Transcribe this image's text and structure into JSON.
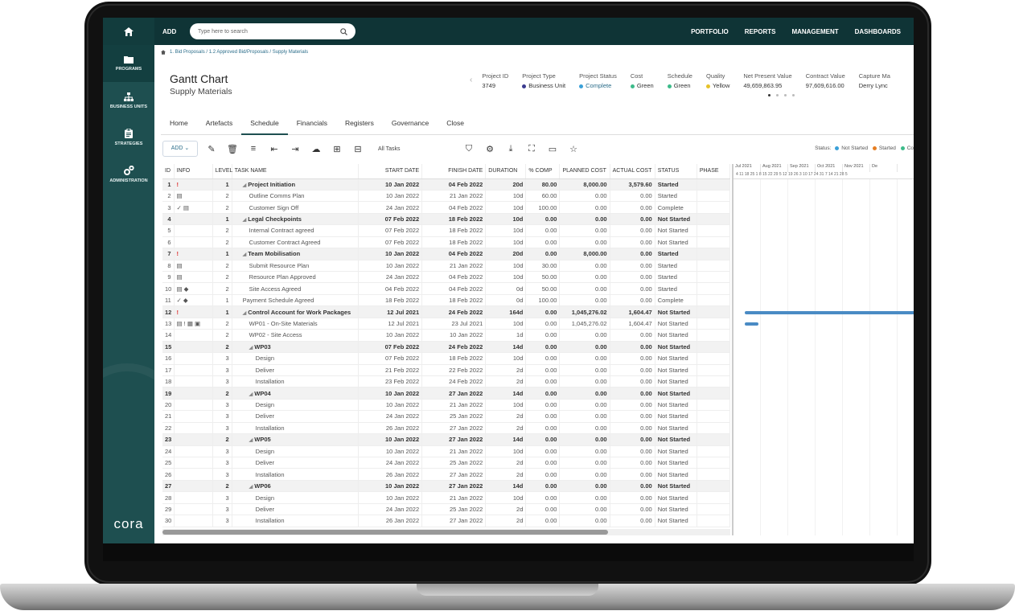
{
  "nav": {
    "items": [
      {
        "label": "PROGRAMS"
      },
      {
        "label": "BUSINESS UNITS"
      },
      {
        "label": "STRATEGIES"
      },
      {
        "label": "ADMINISTRATION"
      }
    ],
    "logo": "cora"
  },
  "topbar": {
    "add_label": "ADD",
    "search_placeholder": "Type here to search",
    "links": [
      "PORTFOLIO",
      "REPORTS",
      "MANAGEMENT",
      "DASHBOARDS"
    ]
  },
  "breadcrumb": "1. Bid Proposals / 1.2 Approved Bid/Proposals / Supply Materials",
  "page": {
    "title": "Gantt Chart",
    "subtitle": "Supply Materials"
  },
  "meta": [
    {
      "label": "Project ID",
      "value": "3749",
      "dot": ""
    },
    {
      "label": "Project Type",
      "value": "Business Unit",
      "dot": "#3b3b8f"
    },
    {
      "label": "Project Status",
      "value": "Complete",
      "dot": "#3aa0d8"
    },
    {
      "label": "Cost",
      "value": "Green",
      "dot": "#3dbb8a"
    },
    {
      "label": "Schedule",
      "value": "Green",
      "dot": "#3dbb8a"
    },
    {
      "label": "Quality",
      "value": "Yellow",
      "dot": "#e6c229"
    },
    {
      "label": "Net Present Value",
      "value": "49,659,863.95",
      "dot": ""
    },
    {
      "label": "Contract Value",
      "value": "97,609,616.00",
      "dot": ""
    },
    {
      "label": "Capture Ma",
      "value": "Derry Lync",
      "dot": ""
    }
  ],
  "tabs": [
    "Home",
    "Artefacts",
    "Schedule",
    "Financials",
    "Registers",
    "Governance",
    "Close"
  ],
  "selected_tab": "Schedule",
  "toolbar": {
    "add_label": "ADD",
    "filter_label": "All Tasks",
    "status_legend": [
      "Status:",
      "Not Started",
      "Started",
      "Co"
    ]
  },
  "columns": [
    "ID",
    "INFO",
    "LEVEL",
    "TASK NAME",
    "START DATE",
    "FINISH DATE",
    "DURATION",
    "% COMP",
    "PLANNED COST",
    "ACTUAL COST",
    "STATUS",
    "PHASE"
  ],
  "rows": [
    {
      "id": "1",
      "info": "!",
      "level": "1",
      "name": "Project Initiation",
      "start": "10 Jan 2022",
      "finish": "04 Feb 2022",
      "dur": "20d",
      "pct": "80.00",
      "planned": "8,000.00",
      "actual": "3,579.60",
      "status": "Started",
      "bold": true,
      "indent": 1
    },
    {
      "id": "2",
      "info": "▤",
      "level": "2",
      "name": "Outline Comms Plan",
      "start": "10 Jan 2022",
      "finish": "21 Jan 2022",
      "dur": "10d",
      "pct": "60.00",
      "planned": "0.00",
      "actual": "0.00",
      "status": "Started",
      "bold": false,
      "indent": 2
    },
    {
      "id": "3",
      "info": "✓ ▤",
      "level": "2",
      "name": "Customer Sign Off",
      "start": "24 Jan 2022",
      "finish": "04 Feb 2022",
      "dur": "10d",
      "pct": "100.00",
      "planned": "0.00",
      "actual": "0.00",
      "status": "Complete",
      "bold": false,
      "indent": 2
    },
    {
      "id": "4",
      "info": "",
      "level": "1",
      "name": "Legal Checkpoints",
      "start": "07 Feb 2022",
      "finish": "18 Feb 2022",
      "dur": "10d",
      "pct": "0.00",
      "planned": "0.00",
      "actual": "0.00",
      "status": "Not Started",
      "bold": true,
      "indent": 1
    },
    {
      "id": "5",
      "info": "",
      "level": "2",
      "name": "Internal Contract agreed",
      "start": "07 Feb 2022",
      "finish": "18 Feb 2022",
      "dur": "10d",
      "pct": "0.00",
      "planned": "0.00",
      "actual": "0.00",
      "status": "Not Started",
      "bold": false,
      "indent": 2
    },
    {
      "id": "6",
      "info": "",
      "level": "2",
      "name": "Customer Contract Agreed",
      "start": "07 Feb 2022",
      "finish": "18 Feb 2022",
      "dur": "10d",
      "pct": "0.00",
      "planned": "0.00",
      "actual": "0.00",
      "status": "Not Started",
      "bold": false,
      "indent": 2
    },
    {
      "id": "7",
      "info": "!",
      "level": "1",
      "name": "Team Mobilisation",
      "start": "10 Jan 2022",
      "finish": "04 Feb 2022",
      "dur": "20d",
      "pct": "0.00",
      "planned": "8,000.00",
      "actual": "0.00",
      "status": "Started",
      "bold": true,
      "indent": 1
    },
    {
      "id": "8",
      "info": "▤",
      "level": "2",
      "name": "Submit Resource Plan",
      "start": "10 Jan 2022",
      "finish": "21 Jan 2022",
      "dur": "10d",
      "pct": "30.00",
      "planned": "0.00",
      "actual": "0.00",
      "status": "Started",
      "bold": false,
      "indent": 2
    },
    {
      "id": "9",
      "info": "▤",
      "level": "2",
      "name": "Resource Plan Approved",
      "start": "24 Jan 2022",
      "finish": "04 Feb 2022",
      "dur": "10d",
      "pct": "50.00",
      "planned": "0.00",
      "actual": "0.00",
      "status": "Started",
      "bold": false,
      "indent": 2
    },
    {
      "id": "10",
      "info": "▤ ◆",
      "level": "2",
      "name": "Site Access Agreed",
      "start": "04 Feb 2022",
      "finish": "04 Feb 2022",
      "dur": "0d",
      "pct": "50.00",
      "planned": "0.00",
      "actual": "0.00",
      "status": "Started",
      "bold": false,
      "indent": 2
    },
    {
      "id": "11",
      "info": "✓ ◆",
      "level": "1",
      "name": "Payment Schedule Agreed",
      "start": "18 Feb 2022",
      "finish": "18 Feb 2022",
      "dur": "0d",
      "pct": "100.00",
      "planned": "0.00",
      "actual": "0.00",
      "status": "Complete",
      "bold": false,
      "indent": 1
    },
    {
      "id": "12",
      "info": "!",
      "level": "1",
      "name": "Control Account for Work Packages",
      "start": "12 Jul 2021",
      "finish": "24 Feb 2022",
      "dur": "164d",
      "pct": "0.00",
      "planned": "1,045,276.02",
      "actual": "1,604.47",
      "status": "Not Started",
      "bold": true,
      "indent": 1
    },
    {
      "id": "13",
      "info": "▤ ! ▦ ▣",
      "level": "2",
      "name": "WP01 - On-Site Materials",
      "start": "12 Jul 2021",
      "finish": "23 Jul 2021",
      "dur": "10d",
      "pct": "0.00",
      "planned": "1,045,276.02",
      "actual": "1,604.47",
      "status": "Not Started",
      "bold": false,
      "indent": 2
    },
    {
      "id": "14",
      "info": "",
      "level": "2",
      "name": "WP02 - Site Access",
      "start": "10 Jan 2022",
      "finish": "10 Jan 2022",
      "dur": "1d",
      "pct": "0.00",
      "planned": "0.00",
      "actual": "0.00",
      "status": "Not Started",
      "bold": false,
      "indent": 2
    },
    {
      "id": "15",
      "info": "",
      "level": "2",
      "name": "WP03",
      "start": "07 Feb 2022",
      "finish": "24 Feb 2022",
      "dur": "14d",
      "pct": "0.00",
      "planned": "0.00",
      "actual": "0.00",
      "status": "Not Started",
      "bold": true,
      "indent": 2
    },
    {
      "id": "16",
      "info": "",
      "level": "3",
      "name": "Design",
      "start": "07 Feb 2022",
      "finish": "18 Feb 2022",
      "dur": "10d",
      "pct": "0.00",
      "planned": "0.00",
      "actual": "0.00",
      "status": "Not Started",
      "bold": false,
      "indent": 3
    },
    {
      "id": "17",
      "info": "",
      "level": "3",
      "name": "Deliver",
      "start": "21 Feb 2022",
      "finish": "22 Feb 2022",
      "dur": "2d",
      "pct": "0.00",
      "planned": "0.00",
      "actual": "0.00",
      "status": "Not Started",
      "bold": false,
      "indent": 3
    },
    {
      "id": "18",
      "info": "",
      "level": "3",
      "name": "Installation",
      "start": "23 Feb 2022",
      "finish": "24 Feb 2022",
      "dur": "2d",
      "pct": "0.00",
      "planned": "0.00",
      "actual": "0.00",
      "status": "Not Started",
      "bold": false,
      "indent": 3
    },
    {
      "id": "19",
      "info": "",
      "level": "2",
      "name": "WP04",
      "start": "10 Jan 2022",
      "finish": "27 Jan 2022",
      "dur": "14d",
      "pct": "0.00",
      "planned": "0.00",
      "actual": "0.00",
      "status": "Not Started",
      "bold": true,
      "indent": 2
    },
    {
      "id": "20",
      "info": "",
      "level": "3",
      "name": "Design",
      "start": "10 Jan 2022",
      "finish": "21 Jan 2022",
      "dur": "10d",
      "pct": "0.00",
      "planned": "0.00",
      "actual": "0.00",
      "status": "Not Started",
      "bold": false,
      "indent": 3
    },
    {
      "id": "21",
      "info": "",
      "level": "3",
      "name": "Deliver",
      "start": "24 Jan 2022",
      "finish": "25 Jan 2022",
      "dur": "2d",
      "pct": "0.00",
      "planned": "0.00",
      "actual": "0.00",
      "status": "Not Started",
      "bold": false,
      "indent": 3
    },
    {
      "id": "22",
      "info": "",
      "level": "3",
      "name": "Installation",
      "start": "26 Jan 2022",
      "finish": "27 Jan 2022",
      "dur": "2d",
      "pct": "0.00",
      "planned": "0.00",
      "actual": "0.00",
      "status": "Not Started",
      "bold": false,
      "indent": 3
    },
    {
      "id": "23",
      "info": "",
      "level": "2",
      "name": "WP05",
      "start": "10 Jan 2022",
      "finish": "27 Jan 2022",
      "dur": "14d",
      "pct": "0.00",
      "planned": "0.00",
      "actual": "0.00",
      "status": "Not Started",
      "bold": true,
      "indent": 2
    },
    {
      "id": "24",
      "info": "",
      "level": "3",
      "name": "Design",
      "start": "10 Jan 2022",
      "finish": "21 Jan 2022",
      "dur": "10d",
      "pct": "0.00",
      "planned": "0.00",
      "actual": "0.00",
      "status": "Not Started",
      "bold": false,
      "indent": 3
    },
    {
      "id": "25",
      "info": "",
      "level": "3",
      "name": "Deliver",
      "start": "24 Jan 2022",
      "finish": "25 Jan 2022",
      "dur": "2d",
      "pct": "0.00",
      "planned": "0.00",
      "actual": "0.00",
      "status": "Not Started",
      "bold": false,
      "indent": 3
    },
    {
      "id": "26",
      "info": "",
      "level": "3",
      "name": "Installation",
      "start": "26 Jan 2022",
      "finish": "27 Jan 2022",
      "dur": "2d",
      "pct": "0.00",
      "planned": "0.00",
      "actual": "0.00",
      "status": "Not Started",
      "bold": false,
      "indent": 3
    },
    {
      "id": "27",
      "info": "",
      "level": "2",
      "name": "WP06",
      "start": "10 Jan 2022",
      "finish": "27 Jan 2022",
      "dur": "14d",
      "pct": "0.00",
      "planned": "0.00",
      "actual": "0.00",
      "status": "Not Started",
      "bold": true,
      "indent": 2
    },
    {
      "id": "28",
      "info": "",
      "level": "3",
      "name": "Design",
      "start": "10 Jan 2022",
      "finish": "21 Jan 2022",
      "dur": "10d",
      "pct": "0.00",
      "planned": "0.00",
      "actual": "0.00",
      "status": "Not Started",
      "bold": false,
      "indent": 3
    },
    {
      "id": "29",
      "info": "",
      "level": "3",
      "name": "Deliver",
      "start": "24 Jan 2022",
      "finish": "25 Jan 2022",
      "dur": "2d",
      "pct": "0.00",
      "planned": "0.00",
      "actual": "0.00",
      "status": "Not Started",
      "bold": false,
      "indent": 3
    },
    {
      "id": "30",
      "info": "",
      "level": "3",
      "name": "Installation",
      "start": "26 Jan 2022",
      "finish": "27 Jan 2022",
      "dur": "2d",
      "pct": "0.00",
      "planned": "0.00",
      "actual": "0.00",
      "status": "Not Started",
      "bold": false,
      "indent": 3
    }
  ],
  "gantt": {
    "months": [
      "Jul 2021",
      "Aug 2021",
      "Sep 2021",
      "Oct 2021",
      "Nov 2021",
      "De"
    ],
    "days": "4 11 18 25  1  8 15 22 29  5 12 19 26  3 10 17 24 31  7 14 21 28  5"
  },
  "colors": {
    "nav": "#1e4f50",
    "topbar": "#0f3436",
    "gantt_bar": "#4a8bc4",
    "not_started": "#3aa0d8",
    "started": "#e67e22"
  }
}
